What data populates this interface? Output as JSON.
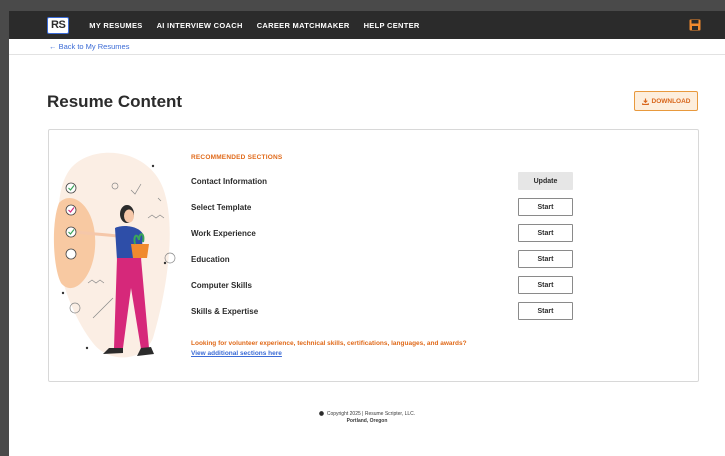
{
  "nav": {
    "logo": "RS",
    "links": [
      "MY RESUMES",
      "AI INTERVIEW COACH",
      "CAREER MATCHMAKER",
      "HELP CENTER"
    ],
    "save_icon": "floppy-disk-icon"
  },
  "subnav": {
    "back_label": "← Back to My Resumes"
  },
  "page": {
    "title": "Resume Content",
    "download_label": "DOWNLOAD",
    "download_icon": "download-icon"
  },
  "sections": {
    "header": "RECOMMENDED SECTIONS",
    "items": [
      {
        "label": "Contact Information",
        "action": "Update"
      },
      {
        "label": "Select Template",
        "action": "Start"
      },
      {
        "label": "Work Experience",
        "action": "Start"
      },
      {
        "label": "Education",
        "action": "Start"
      },
      {
        "label": "Computer Skills",
        "action": "Start"
      },
      {
        "label": "Skills & Expertise",
        "action": "Start"
      }
    ],
    "extra_text": "Looking for volunteer experience, technical skills, certifications, languages, and awards?",
    "extra_link": "View additional sections here"
  },
  "footer": {
    "copyright": "Copyright 2025 | Resume Scripter, LLC.",
    "location": "Portland, Oregon"
  },
  "colors": {
    "navbar": "#2b2b2b",
    "accent_orange": "#e06a1a",
    "link_blue": "#3b6bd6",
    "download_bg": "#fdeedd"
  }
}
